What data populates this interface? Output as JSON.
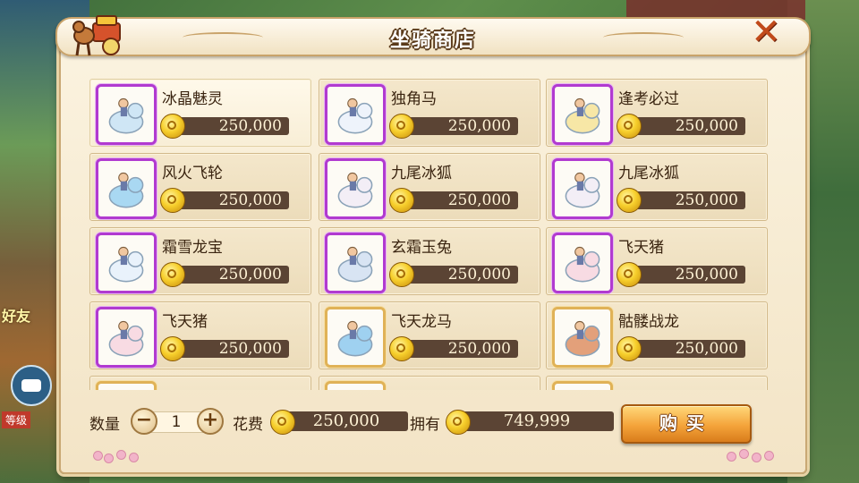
{
  "shop": {
    "title": "坐骑商店",
    "close_icon": "close-icon",
    "items": [
      {
        "name": "冰晶魅灵",
        "price": "250,000",
        "frame": "purple",
        "selected": true
      },
      {
        "name": "独角马",
        "price": "250,000",
        "frame": "purple",
        "selected": false
      },
      {
        "name": "逢考必过",
        "price": "250,000",
        "frame": "purple",
        "selected": false
      },
      {
        "name": "风火飞轮",
        "price": "250,000",
        "frame": "purple",
        "selected": false
      },
      {
        "name": "九尾冰狐",
        "price": "250,000",
        "frame": "purple",
        "selected": false
      },
      {
        "name": "九尾冰狐",
        "price": "250,000",
        "frame": "purple",
        "selected": false
      },
      {
        "name": "霜雪龙宝",
        "price": "250,000",
        "frame": "purple",
        "selected": false
      },
      {
        "name": "玄霜玉兔",
        "price": "250,000",
        "frame": "purple",
        "selected": false
      },
      {
        "name": "飞天猪",
        "price": "250,000",
        "frame": "purple",
        "selected": false
      },
      {
        "name": "飞天猪",
        "price": "250,000",
        "frame": "purple",
        "selected": false
      },
      {
        "name": "飞天龙马",
        "price": "250,000",
        "frame": "gold",
        "selected": false
      },
      {
        "name": "骷髅战龙",
        "price": "250,000",
        "frame": "gold",
        "selected": false
      }
    ]
  },
  "purchase": {
    "quantity_label": "数量",
    "quantity_value": "1",
    "minus_label": "−",
    "plus_label": "+",
    "cost_label": "花费",
    "cost_value": "250,000",
    "own_label": "拥有",
    "own_value": "749,999",
    "buy_label": "购买"
  },
  "background": {
    "friend_label": "好友",
    "level_tag": "等级"
  },
  "colors": {
    "purple_frame": "#b13ad0",
    "gold_frame": "#e0b257",
    "price_bar": "#5b4434",
    "buy_button": "#f4a33a"
  }
}
